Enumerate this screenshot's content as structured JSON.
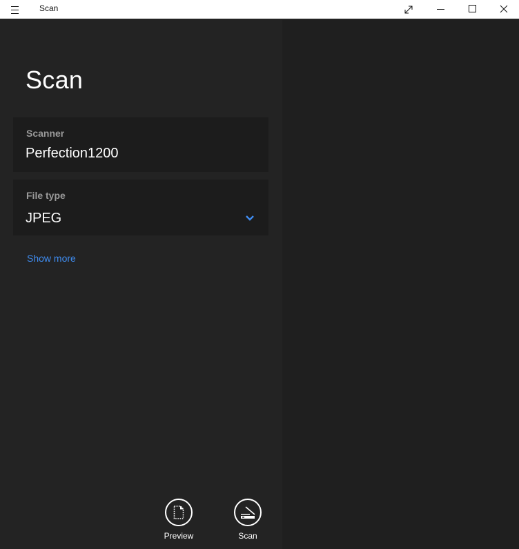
{
  "titlebar": {
    "title": "Scan",
    "icons": {
      "menu": "hamburger-icon",
      "fullscreen": "expand-diagonal-icon",
      "minimize": "minimize-icon",
      "maximize": "maximize-icon",
      "close": "close-icon"
    }
  },
  "main": {
    "page_title": "Scan",
    "scanner": {
      "label": "Scanner",
      "value": "Perfection1200"
    },
    "file_type": {
      "label": "File type",
      "value": "JPEG",
      "icon": "chevron-down-icon"
    },
    "show_more": "Show more",
    "actions": [
      {
        "label": "Preview",
        "icon": "preview-document-icon"
      },
      {
        "label": "Scan",
        "icon": "scanner-icon"
      }
    ]
  },
  "colors": {
    "accent": "#3f8cf0",
    "left_pane_bg": "#232323",
    "right_pane_bg": "#1f1f1f",
    "field_bg": "#1c1c1c",
    "titlebar_bg": "#ffffff"
  }
}
